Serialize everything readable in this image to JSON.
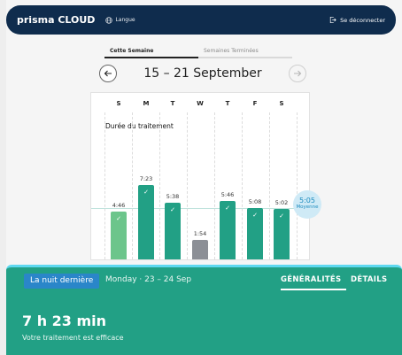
{
  "header": {
    "brand": "prisma CLOUD",
    "language_label": "Langue",
    "logout_label": "Se déconnecter"
  },
  "week_tabs": [
    {
      "label": "Cette Semaine",
      "active": true
    },
    {
      "label": "Semaines Terminées",
      "active": false
    }
  ],
  "week_nav": {
    "range": "15 – 21 September",
    "prev_icon": "arrow-left-icon",
    "next_icon": "arrow-right-icon"
  },
  "chart_data": {
    "type": "bar",
    "title": "Durée du traitement",
    "categories": [
      "S",
      "M",
      "T",
      "W",
      "T",
      "F",
      "S"
    ],
    "values": [
      "4:46",
      "7:23",
      "5:38",
      "1:54",
      "5:46",
      "5:08",
      "5:02"
    ],
    "values_minutes": [
      286,
      443,
      338,
      114,
      346,
      308,
      302
    ],
    "bar_states": [
      "good",
      "good",
      "good",
      "insufficient",
      "good",
      "good",
      "good"
    ],
    "average": {
      "value": "5:05",
      "minutes": 305,
      "label": "Moyenne"
    },
    "colors": {
      "good": "#22a085",
      "highlight": "#6cc58b",
      "insufficient": "#8c8f96",
      "average_line": "#bfe3dc",
      "average_bubble": "#cfeaf6"
    }
  },
  "panel": {
    "chip": "La nuit dernière",
    "date": "Monday · 23 – 24 Sep",
    "tabs": [
      "GÉNÉRALITÉS",
      "DÉTAILS"
    ],
    "active_tab": "GÉNÉRALITÉS",
    "duration": "7 h 23 min",
    "subtitle": "Votre traitement est efficace"
  }
}
